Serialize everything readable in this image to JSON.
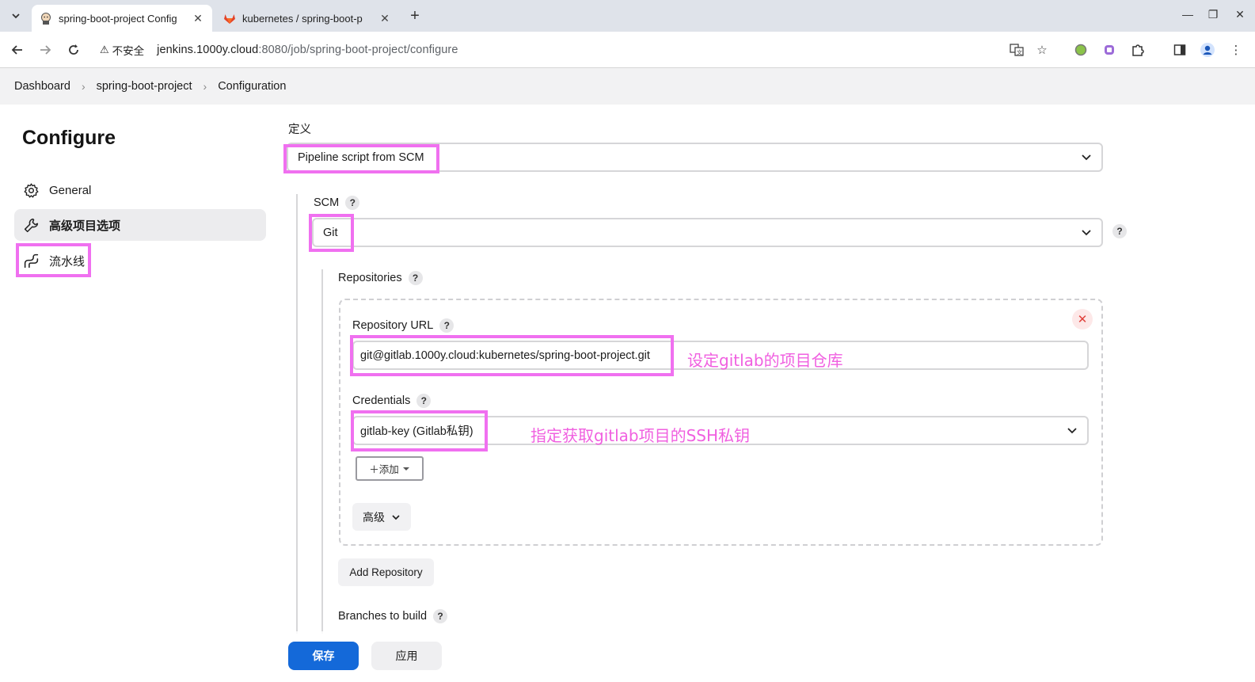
{
  "browser": {
    "tabs": [
      {
        "title": "spring-boot-project Config",
        "active": true,
        "icon": "jenkins-icon"
      },
      {
        "title": "kubernetes / spring-boot-p",
        "active": false,
        "icon": "gitlab-icon"
      }
    ],
    "security_label": "不安全",
    "url_host": "jenkins.1000y.cloud",
    "url_rest": ":8080/job/spring-boot-project/configure"
  },
  "breadcrumb": {
    "items": [
      "Dashboard",
      "spring-boot-project",
      "Configuration"
    ]
  },
  "sidebar": {
    "title": "Configure",
    "items": [
      {
        "label": "General",
        "icon": "gear-icon"
      },
      {
        "label": "高级项目选项",
        "icon": "wrench-icon",
        "active": true
      },
      {
        "label": "流水线",
        "icon": "pipeline-icon"
      }
    ]
  },
  "form": {
    "definition_label": "定义",
    "definition_value": "Pipeline script from SCM",
    "scm_label": "SCM",
    "scm_value": "Git",
    "repositories_label": "Repositories",
    "repo_url_label": "Repository URL",
    "repo_url_value": "git@gitlab.1000y.cloud:kubernetes/spring-boot-project.git",
    "credentials_label": "Credentials",
    "credentials_value": "gitlab-key (Gitlab私钥)",
    "add_button": "＋添加",
    "advanced_button": "高级",
    "add_repository_button": "Add Repository",
    "branches_label": "Branches to build",
    "help_glyph": "?"
  },
  "annotations": {
    "repo_note": "设定gitlab的项目仓库",
    "cred_note": "指定获取gitlab项目的SSH私钥"
  },
  "footer": {
    "save_label": "保存",
    "apply_label": "应用"
  },
  "colors": {
    "highlight": "#f070f0",
    "annotation": "#f060e0",
    "primary": "#1469d9"
  }
}
